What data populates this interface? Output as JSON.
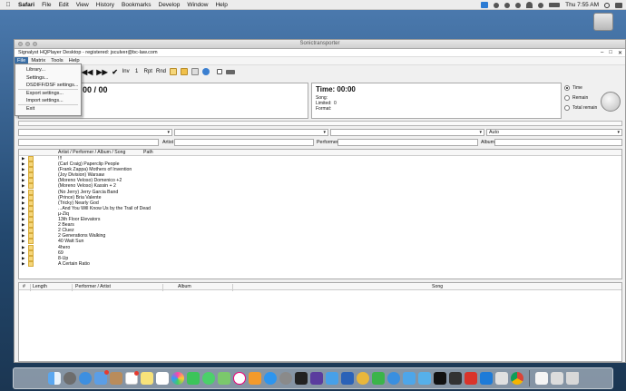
{
  "menubar": {
    "app": "Safari",
    "items": [
      "File",
      "Edit",
      "View",
      "History",
      "Bookmarks",
      "Develop",
      "Window",
      "Help"
    ],
    "clock": "Thu 7:55 AM"
  },
  "desktop": {
    "drive_label": ""
  },
  "window": {
    "title": "Sonictransporter",
    "app_title": "Signalyst HQPlayer Desktop - registered: jsculver@bc-law.com",
    "controls": [
      "–",
      "□",
      "✕"
    ],
    "menu": [
      "File",
      "Matrix",
      "Tools",
      "Help"
    ],
    "toolbar": {
      "buttons": [
        {
          "name": "prev-icon",
          "label": "◀◀"
        },
        {
          "name": "next-icon",
          "label": "▶▶"
        },
        {
          "name": "check-icon",
          "label": "✔"
        },
        {
          "name": "inv",
          "label": "Inv"
        },
        {
          "name": "one",
          "label": "1"
        },
        {
          "name": "rpt",
          "label": "Rpt"
        },
        {
          "name": "rnd",
          "label": "Rnd"
        }
      ]
    },
    "file_menu": {
      "items": [
        "Library...",
        "Settings...",
        "DSDIFF/DSF settings...",
        "Export settings...",
        "Import settings...",
        "Exit"
      ]
    },
    "panel_left": {
      "time": "00 / 00"
    },
    "panel_right": {
      "time": "Time: 00:00",
      "song_label": "Song:",
      "limited_label": "Limited:",
      "limited_value": "0",
      "format_label": "Format:"
    },
    "time_mode": {
      "options": [
        "Time",
        "Remain",
        "Total remain"
      ],
      "selected_index": 0
    },
    "filters": {
      "auto": "Auto"
    },
    "search": {
      "artist": "Artist",
      "performer": "Performer",
      "album": "Album"
    },
    "library": {
      "headers": [
        "Artist / Performer / Album / Song",
        "Path"
      ],
      "rows": [
        "!!!",
        "(Carl Craig) Paperclip People",
        "(Frank Zappa) Mothers of Invention",
        "(Joy Division) Warsaw",
        "(Moreno Veloso) Domenico +2",
        "(Moreno Veloso) Kassin + 2",
        "(No Jerry) Jerry Garcia Band",
        "(Prince) Bria Valente",
        "(Tricky) Nearly God",
        "...And You Will Know Us by the Trail of Dead",
        "µ-Ziq",
        "13th Floor Elevators",
        "2 Bears",
        "2 Cluez",
        "2 Generations Walking",
        "40 Watt Sun",
        "4hero",
        "69",
        "8-Up",
        "A Certain Ratio"
      ]
    },
    "playlist": {
      "headers": [
        "#",
        "Length",
        "Performer / Artist",
        "Album",
        "Song"
      ]
    }
  },
  "colors": {
    "menu_highlight": "#3a6ea5",
    "folder": "#f5d67a"
  }
}
